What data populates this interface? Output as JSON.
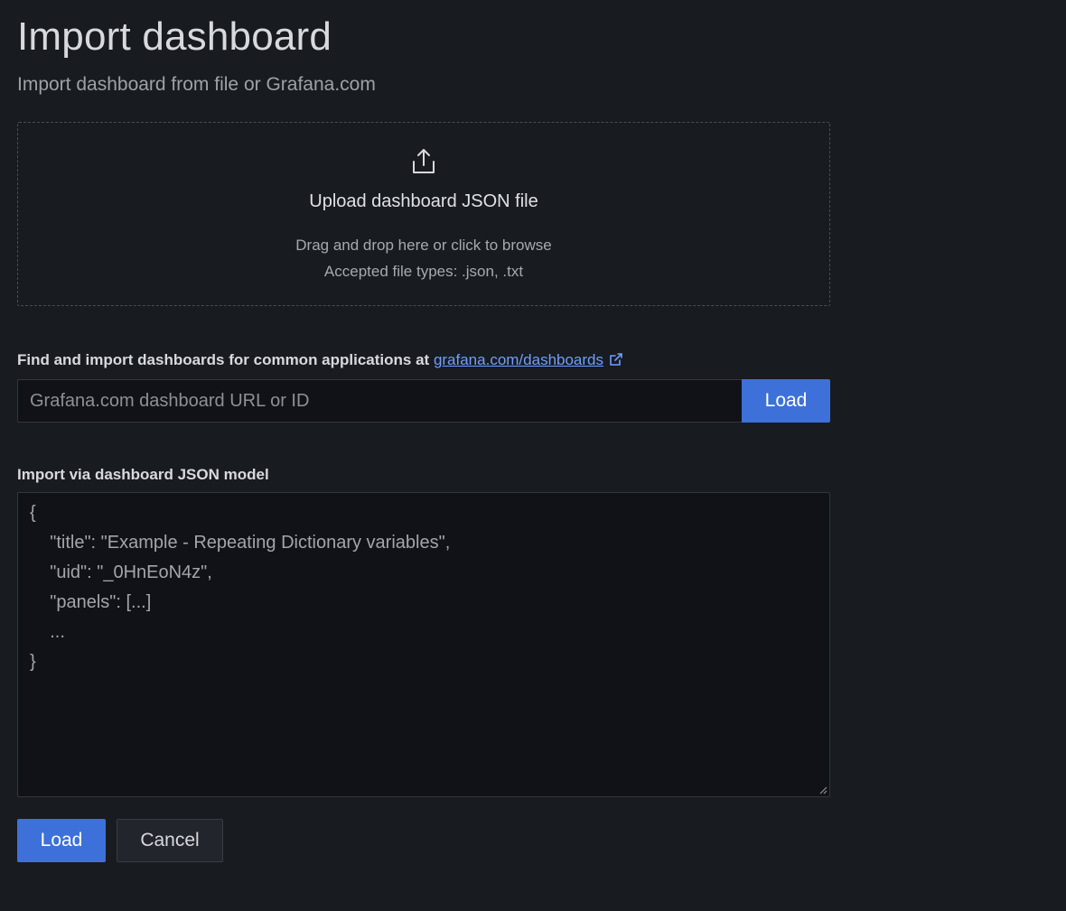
{
  "header": {
    "title": "Import dashboard",
    "subtitle": "Import dashboard from file or Grafana.com"
  },
  "upload": {
    "icon": "upload-icon",
    "title": "Upload dashboard JSON file",
    "hint_line1": "Drag and drop here or click to browse",
    "hint_line2": "Accepted file types: .json, .txt"
  },
  "grafana_com": {
    "label": "Find and import dashboards for common applications at ",
    "link_text": "grafana.com/dashboards",
    "link_icon": "external-link-icon",
    "input_value": "",
    "input_placeholder": "Grafana.com dashboard URL or ID",
    "load_label": "Load"
  },
  "json_model": {
    "label": "Import via dashboard JSON model",
    "placeholder": "{\n    \"title\": \"Example - Repeating Dictionary variables\",\n    \"uid\": \"_0HnEoN4z\",\n    \"panels\": [...]\n    ...\n}"
  },
  "actions": {
    "load_label": "Load",
    "cancel_label": "Cancel"
  },
  "colors": {
    "background": "#181b1f",
    "primary": "#3d71d9",
    "link": "#6e9fff",
    "input_bg": "#111217"
  }
}
